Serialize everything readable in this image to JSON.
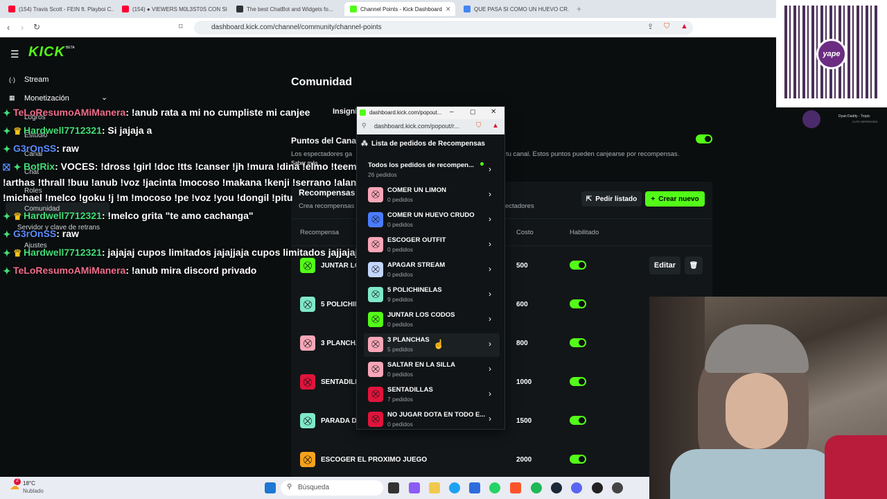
{
  "browser": {
    "tabs": [
      {
        "label": "(154) Travis Scott - FEIN ft. Playboi C...",
        "color": "#ff0033"
      },
      {
        "label": "(154) ● VIEWERS M0L3ST0S CON SIC...",
        "color": "#ff0033"
      },
      {
        "label": "The best ChatBot and Widgets fo...",
        "color": "#333333"
      },
      {
        "label": "Channel Points - Kick Dashboard",
        "color": "#53fc18"
      },
      {
        "label": "QUE PASA SI COMO UN HUEVO CR...",
        "color": "#4285f4"
      }
    ],
    "new_tab": "+",
    "url": "dashboard.kick.com/channel/community/channel-points"
  },
  "qr": {
    "logo_text": "yape"
  },
  "music": {
    "title": "Dyan Daddy - Tropic",
    "subtitle": "CUTE DEPRESSED"
  },
  "sidebar": {
    "logo": "KICK",
    "beta": "BETA",
    "items": [
      "Stream",
      "Monetización",
      "Logros",
      "Estudio",
      "Canal",
      "Chat",
      "Roles",
      "Comunidad",
      "Servidor y clave de retrans",
      "Ajustes"
    ]
  },
  "page": {
    "title": "Comunidad",
    "tab": "Insigni",
    "points_title": "Puntos del Cana",
    "points_desc_left": "Los espectadores ga",
    "points_desc_right": "tu canal. Estos puntos pueden canjearse por recompensas.",
    "saber_mas": "Saber más",
    "rewards_title": "Recompensas",
    "rewards_sub_left": "Crea recompensas",
    "rewards_sub_right": "ectadores",
    "btn_listado": "Pedir listado",
    "btn_nuevo": "Crear nuevo",
    "col_reward": "Recompensa",
    "col_cost": "Costo",
    "col_enabled": "Habilitado",
    "edit": "Editar"
  },
  "rewards": [
    {
      "name": "JUNTAR LO",
      "cost": "500",
      "color": "#53fc18"
    },
    {
      "name": "5 POLICHIN",
      "cost": "600",
      "color": "#7fe8c8"
    },
    {
      "name": "3 PLANCHA",
      "cost": "800",
      "color": "#f7a6b8"
    },
    {
      "name": "SENTADILL",
      "cost": "1000",
      "color": "#e0143c"
    },
    {
      "name": "PARADA DE",
      "cost": "1500",
      "color": "#7fe8c8"
    },
    {
      "name": "ESCOGER EL PROXIMO JUEGO",
      "cost": "2000",
      "color": "#f7a21b"
    }
  ],
  "chat": [
    {
      "user": "TeLoResumoAMiManera",
      "msg": ": !anub rata a mi no cumpliste mi canjee",
      "color": "pink"
    },
    {
      "user": "Hardwell7712321",
      "msg": ": Si jajaja a",
      "color": "green"
    },
    {
      "user": "G3rOnSS",
      "msg": ": raw",
      "color": "blue"
    },
    {
      "user": "BotRix",
      "msg": ": VOCES: !dross !girl !doc !tts !canser !jh !mura !dina !elmo !teemo",
      "color": "green"
    },
    {
      "user": "",
      "msg": "!arthas !thrall !buu !anub !voz !jacinta !mocoso !makana !kenji !serrano !alan",
      "color": "none"
    },
    {
      "user": "",
      "msg": "!michael !melco !goku !j !m !mocoso !pe !voz !you !dongil !pitu",
      "color": "none"
    },
    {
      "user": "Hardwell7712321",
      "msg": ": !melco grita \"te amo cachanga\"",
      "color": "green"
    },
    {
      "user": "G3rOnSS",
      "msg": ": raw",
      "color": "blue"
    },
    {
      "user": "Hardwell7712321",
      "msg": ": jajajaj cupos limitados jajajjaja cupos limitados jajjajaja",
      "color": "green"
    },
    {
      "user": "TeLoResumoAMiManera",
      "msg": ": !anub mira discord privado",
      "color": "pink"
    }
  ],
  "popout": {
    "window_title": "dashboard.kick.com/popout...",
    "url": "dashboard.kick.com/popout/r...",
    "header": "Lista de pedidos de Recompensas",
    "all_title": "Todos los pedidos de recompen...",
    "all_count": "26 pedidos",
    "items": [
      {
        "name": "COMER UN LIMON",
        "count": "0 pedidos",
        "color": "#f7a6b8"
      },
      {
        "name": "COMER UN HUEVO CRUDO",
        "count": "0 pedidos",
        "color": "#4a7cff"
      },
      {
        "name": "ESCOGER OUTFIT",
        "count": "0 pedidos",
        "color": "#f7a6b8"
      },
      {
        "name": "APAGAR STREAM",
        "count": "0 pedidos",
        "color": "#c3d7ff"
      },
      {
        "name": "5 POLICHINELAS",
        "count": "9 pedidos",
        "color": "#7fe8c8"
      },
      {
        "name": "JUNTAR LOS CODOS",
        "count": "0 pedidos",
        "color": "#53fc18"
      },
      {
        "name": "3 PLANCHAS",
        "count": "5 pedidos",
        "color": "#f7a6b8"
      },
      {
        "name": "SALTAR EN LA SILLA",
        "count": "0 pedidos",
        "color": "#f7a6b8"
      },
      {
        "name": "SENTADILLAS",
        "count": "7 pedidos",
        "color": "#e0143c"
      },
      {
        "name": "NO JUGAR DOTA EN TODO E...",
        "count": "0 pedidos",
        "color": "#e0143c"
      }
    ]
  },
  "taskbar": {
    "temp": "18°C",
    "weather": "Nublado",
    "search": "Búsqueda",
    "badge": "2"
  }
}
